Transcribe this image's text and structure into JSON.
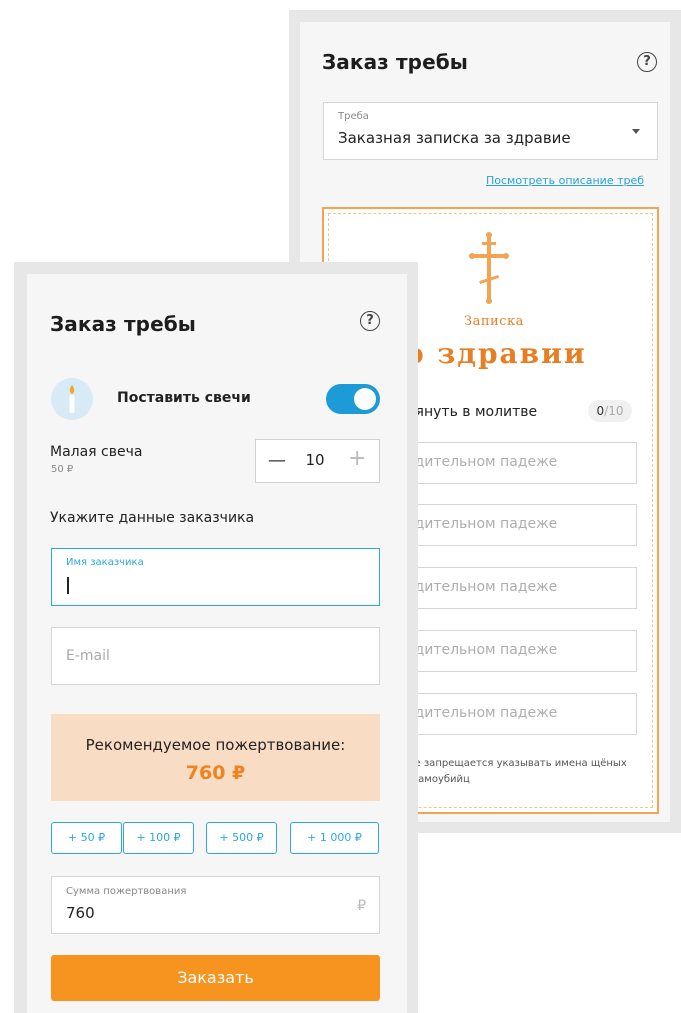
{
  "back_card": {
    "title": "Заказ требы",
    "help_icon": "question-circle-icon",
    "treba_select": {
      "label": "Треба",
      "value": "Заказная записка за здравие"
    },
    "description_link": "Посмотреть описание треб",
    "note": {
      "heading_small": "Записка",
      "heading_large": "о здравии",
      "remember_label": "мянуть в молитве",
      "counter_current": "0",
      "counter_max": "/10",
      "name_placeholders": [
        "одительном падеже",
        "одительном падеже",
        "одительном падеже",
        "одительном падеже",
        "одительном падеже"
      ],
      "warning": "ске запрещается указывать имена щёных и самоубийц"
    }
  },
  "front_card": {
    "title": "Заказ требы",
    "help_icon": "question-circle-icon",
    "candles_toggle": {
      "label": "Поставить свечи",
      "on": true
    },
    "small_candle": {
      "name": "Малая свеча",
      "price": "50 ₽",
      "quantity": "10"
    },
    "customer_section_title": "Укажите данные заказчика",
    "name_field": {
      "label": "Имя заказчика",
      "value": ""
    },
    "email_field": {
      "placeholder": "E-mail"
    },
    "recommended": {
      "label": "Рекомендуемое пожертвование:",
      "amount": "760 ₽"
    },
    "add_buttons": [
      "+ 50 ₽",
      "+ 100 ₽",
      "+ 500 ₽",
      "+ 1 000 ₽"
    ],
    "sum_field": {
      "label": "Сумма пожертвования",
      "value": "760",
      "currency": "₽"
    },
    "submit_label": "Заказать"
  },
  "colors": {
    "accent_blue": "#2ba9dd",
    "toggle_blue": "#1d9bd8",
    "orange": "#f7941f",
    "orange_text": "#ee8321",
    "donation_bg": "#f9dcc4"
  }
}
